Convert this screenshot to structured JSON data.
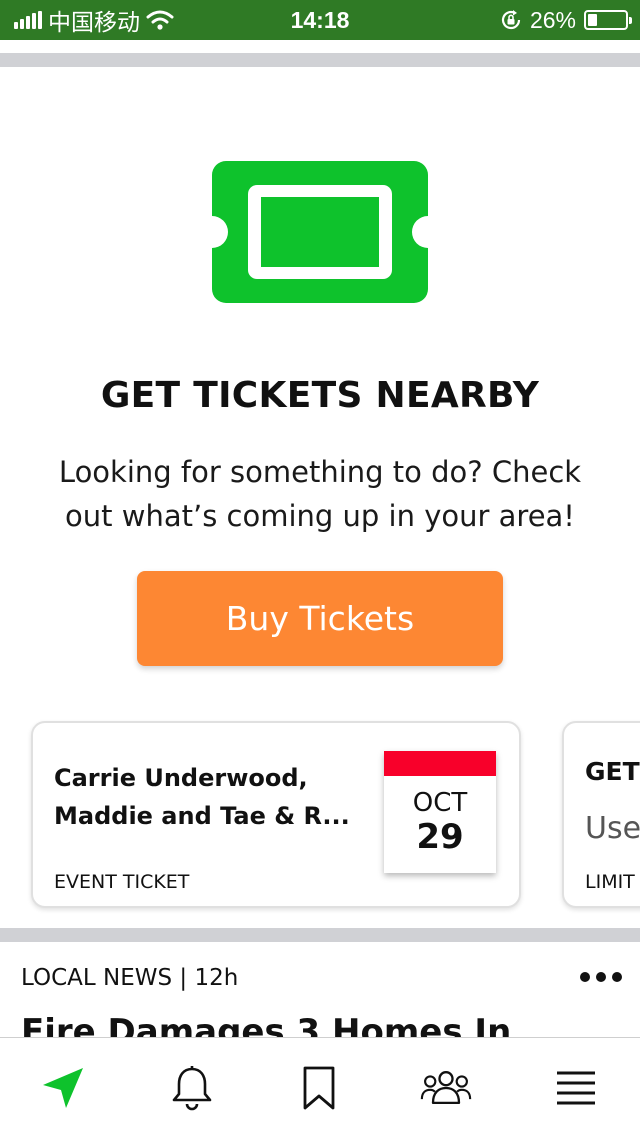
{
  "status_bar": {
    "carrier": "中国移动",
    "time": "14:18",
    "battery_text": "26%",
    "battery_level": 0.26
  },
  "promo": {
    "icon": "ticket-icon",
    "title": "GET TICKETS NEARBY",
    "subtitle_line1": "Looking for something to do? Check",
    "subtitle_line2": "out what’s coming up in your area!",
    "button_label": "Buy Tickets",
    "accent_color": "#0ec22c",
    "button_color": "#fd8733"
  },
  "cards": [
    {
      "title_line1": "Carrie Underwood,",
      "title_line2": "Maddie and Tae & R...",
      "type": "EVENT TICKET",
      "month": "OCT",
      "day": "29",
      "calendar_color": "#f8002a"
    },
    {
      "title": "GET",
      "subtitle": "Use",
      "footer": "LIMIT"
    }
  ],
  "news": {
    "meta": "LOCAL NEWS | 12h",
    "headline": "Fire Damages 3 Homes In"
  },
  "bottom_nav": {
    "active_color": "#0ec22c",
    "items": [
      "navigation-arrow-icon",
      "bell-icon",
      "bookmark-icon",
      "people-icon",
      "menu-icon"
    ]
  }
}
